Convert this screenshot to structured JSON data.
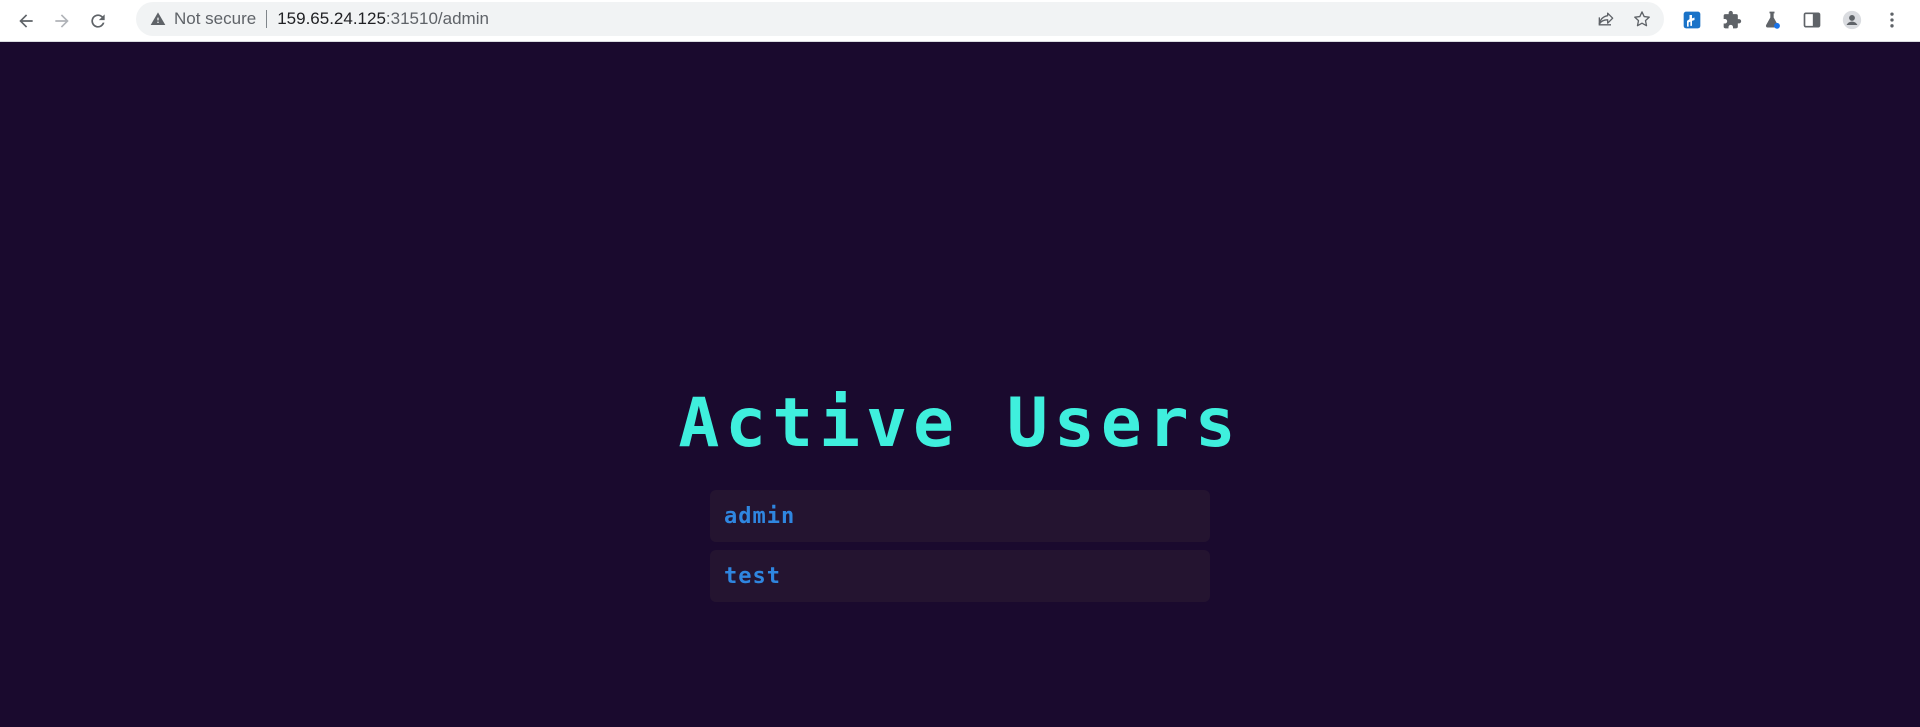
{
  "browser": {
    "security_label": "Not secure",
    "url_host": "159.65.24.125",
    "url_rest": ":31510/admin"
  },
  "icons": {
    "back": "back-arrow-icon",
    "forward": "forward-arrow-icon",
    "reload": "reload-icon",
    "warning": "warning-triangle-icon",
    "share": "share-icon",
    "bookmark": "star-icon",
    "extension": "extension-icon",
    "extensions_menu": "puzzle-icon",
    "labs": "flask-icon",
    "side_panel": "side-panel-icon",
    "profile": "avatar-icon",
    "menu": "kebab-menu-icon"
  },
  "colors": {
    "page_background": "#1a0a2e",
    "title": "#3fefdd",
    "user_text": "#2f86e0",
    "user_row": "#241430"
  },
  "page": {
    "title": "Active Users",
    "users": [
      {
        "name": "admin"
      },
      {
        "name": "test"
      }
    ]
  }
}
